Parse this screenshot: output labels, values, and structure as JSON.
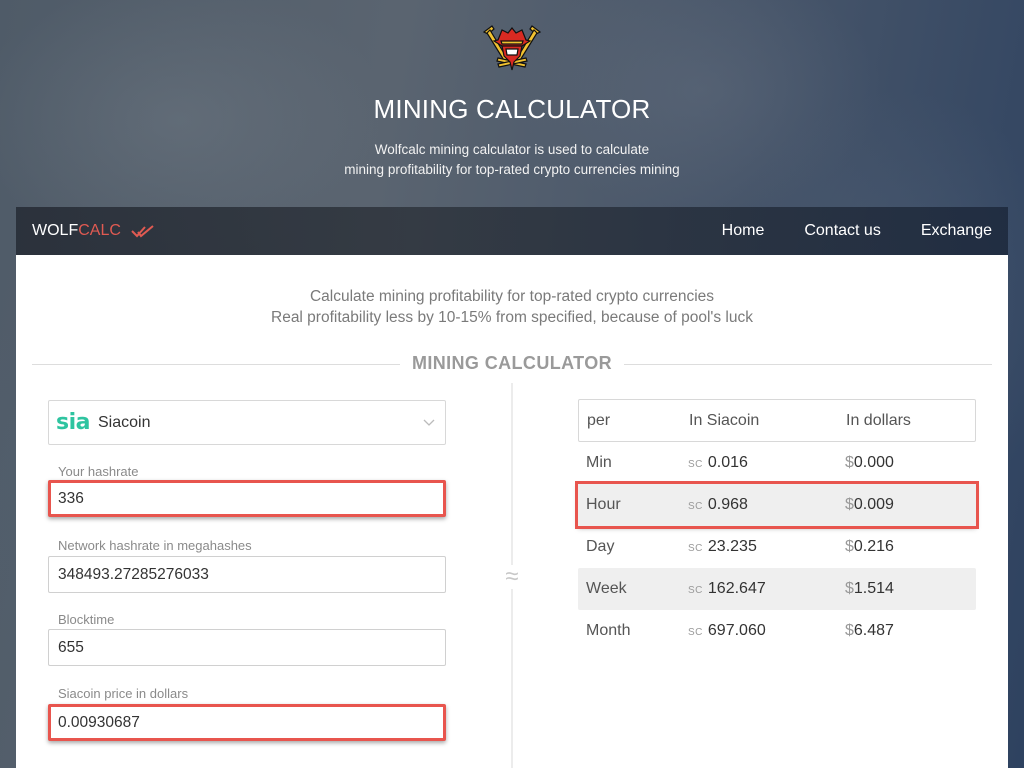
{
  "hero": {
    "title": "MINING CALCULATOR",
    "subtitle_line1": "Wolfcalc mining calculator is used to calculate",
    "subtitle_line2": "mining profitability for top-rated crypto currencies mining",
    "logo_icon": "miner-skull-pickaxes-icon"
  },
  "navbar": {
    "brand_part1": "WOLF",
    "brand_part2": "CALC",
    "brand_icon": "double-check-icon",
    "links": [
      {
        "label": "Home"
      },
      {
        "label": "Contact us"
      },
      {
        "label": "Exchange"
      }
    ]
  },
  "intro": {
    "line1": "Calculate mining profitability for top-rated crypto currencies",
    "line2": "Real profitability less by 10-15% from specified, because of pool's luck"
  },
  "section_title": "MINING CALCULATOR",
  "approx_symbol": "≈",
  "form": {
    "coin": {
      "logo_text": "sia",
      "name": "Siacoin",
      "icon": "chevron-down-icon"
    },
    "fields": [
      {
        "label": "Your hashrate",
        "value": "336",
        "highlighted": true
      },
      {
        "label": "Network hashrate in megahashes",
        "value": "348493.27285276033",
        "highlighted": false
      },
      {
        "label": "Blocktime",
        "value": "655",
        "highlighted": false
      },
      {
        "label": "Siacoin price in dollars",
        "value": "0.00930687",
        "highlighted": true
      }
    ]
  },
  "results": {
    "headers": [
      "per",
      "In Siacoin",
      "In dollars"
    ],
    "coin_unit": "SC",
    "currency_symbol": "$",
    "rows": [
      {
        "period": "Min",
        "coin": "0.016",
        "usd": "0.000",
        "highlighted": false
      },
      {
        "period": "Hour",
        "coin": "0.968",
        "usd": "0.009",
        "highlighted": true
      },
      {
        "period": "Day",
        "coin": "23.235",
        "usd": "0.216",
        "highlighted": false
      },
      {
        "period": "Week",
        "coin": "162.647",
        "usd": "1.514",
        "highlighted": false
      },
      {
        "period": "Month",
        "coin": "697.060",
        "usd": "6.487",
        "highlighted": false
      }
    ]
  },
  "colors": {
    "accent_red": "#e05a52",
    "highlight_border": "#e8554e",
    "sia_green": "#2ec4a0"
  }
}
